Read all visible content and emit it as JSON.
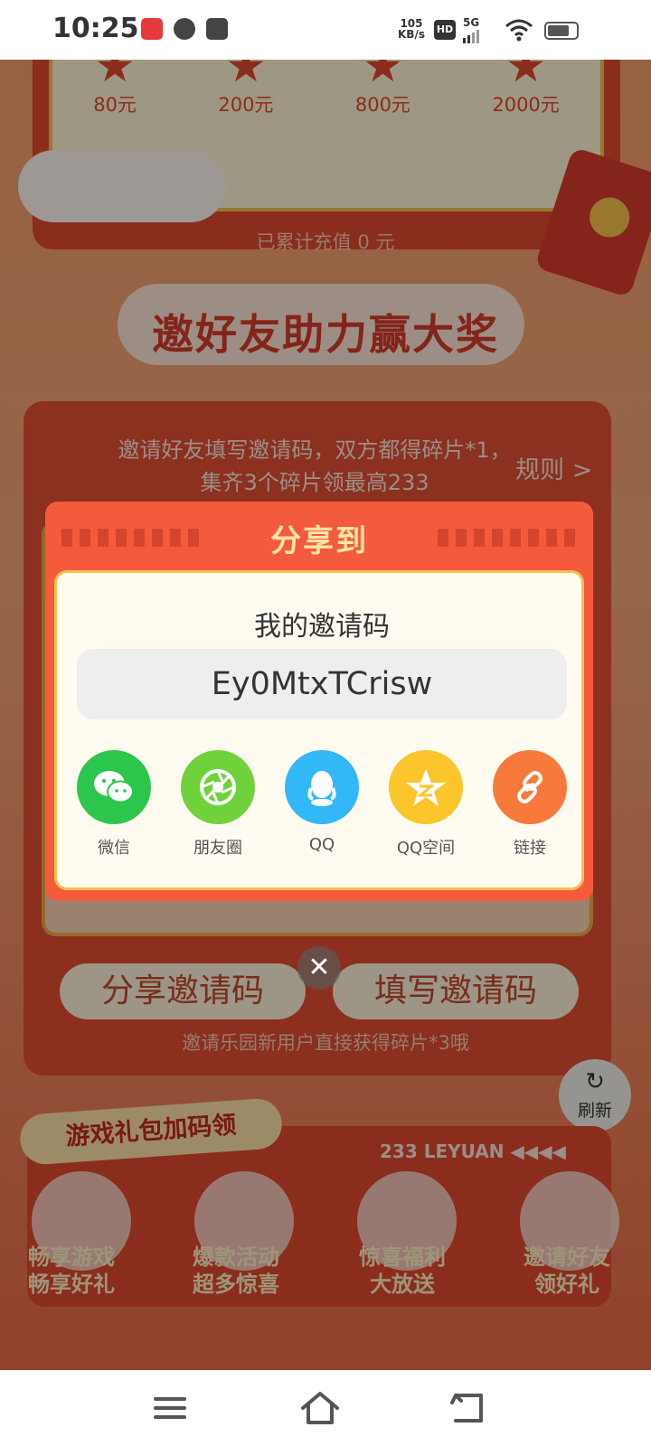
{
  "status_bar": {
    "time": "10:25",
    "net_speed_value": "105",
    "net_speed_unit": "KB/s",
    "hd": "HD",
    "network": "5G",
    "battery_percent": 75
  },
  "background": {
    "tiers": [
      {
        "amount": "80元"
      },
      {
        "amount": "200元"
      },
      {
        "amount": "800元"
      },
      {
        "amount": "2000元"
      }
    ],
    "recharge_total": "已累计充值 0 元",
    "section_title": "邀好友助力赢大奖",
    "invite_desc": "邀请好友填写邀请码，双方都得碎片*1，集齐3个碎片领最高233",
    "rules_link": "规则 >",
    "share_code_button": "分享邀请码",
    "fill_code_button": "填写邀请码",
    "invite_tip": "邀请乐园新用户直接获得碎片*3哦",
    "refresh_label": "刷新",
    "gift_banner": "游戏礼包加码领",
    "leyuan_text": "233 LEYUAN",
    "promos": [
      {
        "line1": "畅享游戏",
        "line2": "畅享好礼"
      },
      {
        "line1": "爆款活动",
        "line2": "超多惊喜"
      },
      {
        "line1": "惊喜福利",
        "line2": "大放送"
      },
      {
        "line1": "邀请好友",
        "line2": "领好礼"
      }
    ]
  },
  "dialog": {
    "title": "分享到",
    "code_title": "我的邀请码",
    "invite_code": "Ey0MtxTCrisw",
    "share_targets": [
      {
        "label": "微信",
        "color": "#2cc64d",
        "icon": "wechat-icon"
      },
      {
        "label": "朋友圈",
        "color": "#6fd23a",
        "icon": "moments-icon"
      },
      {
        "label": "QQ",
        "color": "#33b8f7",
        "icon": "qq-icon"
      },
      {
        "label": "QQ空间",
        "color": "#fbc52b",
        "icon": "qzone-icon"
      },
      {
        "label": "链接",
        "color": "#f77a3c",
        "icon": "link-icon"
      }
    ]
  }
}
